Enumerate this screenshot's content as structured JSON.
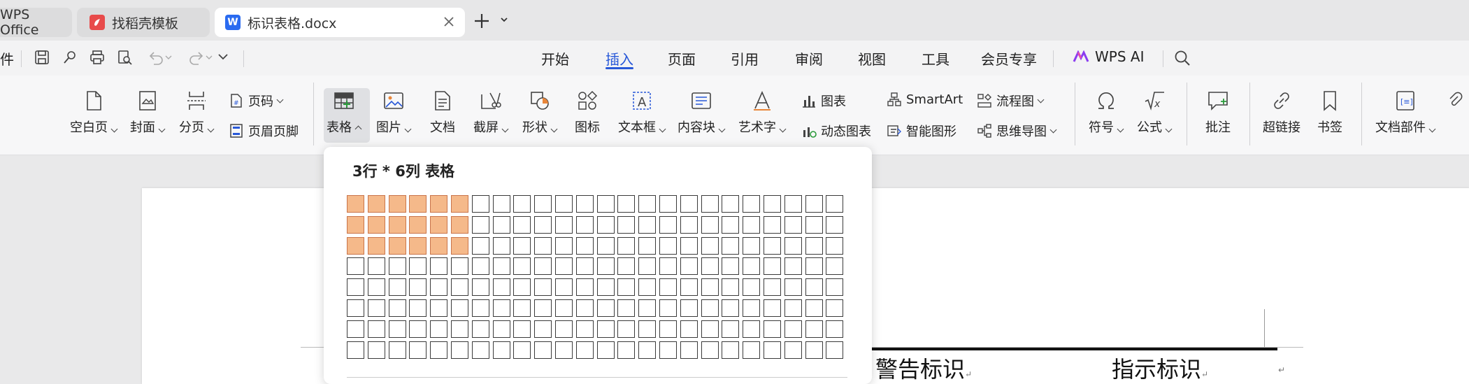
{
  "tabs": [
    {
      "label": "WPS Office"
    },
    {
      "label": "找稻壳模板"
    },
    {
      "label": "标识表格.docx"
    }
  ],
  "quick_access": {
    "left_text": "件"
  },
  "menu": [
    {
      "label": "开始"
    },
    {
      "label": "插入",
      "active": true
    },
    {
      "label": "页面"
    },
    {
      "label": "引用"
    },
    {
      "label": "审阅"
    },
    {
      "label": "视图"
    },
    {
      "label": "工具"
    },
    {
      "label": "会员专享"
    },
    {
      "label": "WPS AI"
    }
  ],
  "ribbon": {
    "blank_page": "空白页",
    "cover": "封面",
    "page_break": "分页",
    "page_number": "页码",
    "header_footer": "页眉页脚",
    "table": "表格",
    "picture": "图片",
    "document": "文档",
    "screenshot": "截屏",
    "shape": "形状",
    "icon": "图标",
    "textbox": "文本框",
    "content_block": "内容块",
    "wordart": "艺术字",
    "chart": "图表",
    "dynamic_chart": "动态图表",
    "smartart": "SmartArt",
    "smart_shape": "智能图形",
    "flowchart": "流程图",
    "mindmap": "思维导图",
    "symbol": "符号",
    "formula": "公式",
    "comment": "批注",
    "hyperlink": "超链接",
    "bookmark": "书签",
    "doc_parts": "文档部件"
  },
  "table_picker": {
    "title": "3行 * 6列 表格",
    "rows": 8,
    "cols": 24,
    "selected_rows": 3,
    "selected_cols": 6,
    "highlight_color": "#f5b98a"
  },
  "document": {
    "cell1": "警告标识",
    "cell2": "指示标识",
    "mark": "↵"
  }
}
